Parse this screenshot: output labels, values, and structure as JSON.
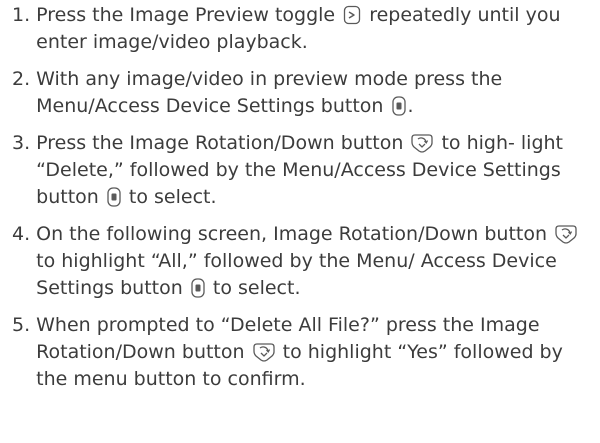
{
  "steps": [
    {
      "number": "1.",
      "parts": [
        {
          "type": "text",
          "value": "Press the Image Preview toggle"
        },
        {
          "type": "icon",
          "name": "image-preview-toggle-icon"
        },
        {
          "type": "text",
          "value": "repeatedly until you enter image/video playback."
        }
      ]
    },
    {
      "number": "2.",
      "parts": [
        {
          "type": "text",
          "value": "With any image/video in preview mode press the Menu/Access Device Settings button"
        },
        {
          "type": "icon",
          "name": "menu-settings-button-icon"
        },
        {
          "type": "text",
          "value": "."
        }
      ]
    },
    {
      "number": "3.",
      "parts": [
        {
          "type": "text",
          "value": "Press the Image Rotation/Down button"
        },
        {
          "type": "icon",
          "name": "rotation-down-button-icon"
        },
        {
          "type": "text",
          "value": "to high- light “Delete,” followed by the Menu/Access Device Settings button"
        },
        {
          "type": "icon",
          "name": "menu-settings-button-icon"
        },
        {
          "type": "text",
          "value": "to select."
        }
      ]
    },
    {
      "number": "4.",
      "parts": [
        {
          "type": "text",
          "value": "On the following screen, Image Rotation/Down button"
        },
        {
          "type": "icon",
          "name": "rotation-down-button-icon"
        },
        {
          "type": "text",
          "value": "to highlight “All,” followed by the Menu/ Access Device Settings button"
        },
        {
          "type": "icon",
          "name": "menu-settings-button-icon"
        },
        {
          "type": "text",
          "value": "to select."
        }
      ]
    },
    {
      "number": "5.",
      "parts": [
        {
          "type": "text",
          "value": "When prompted to “Delete All File?” press the Image Rotation/Down button"
        },
        {
          "type": "icon",
          "name": "rotation-down-button-icon"
        },
        {
          "type": "text",
          "value": "to highlight “Yes” followed by the menu button to confirm."
        }
      ]
    }
  ],
  "colors": {
    "text": "#3c3c3c",
    "icon_stroke": "#5a5a5a"
  }
}
